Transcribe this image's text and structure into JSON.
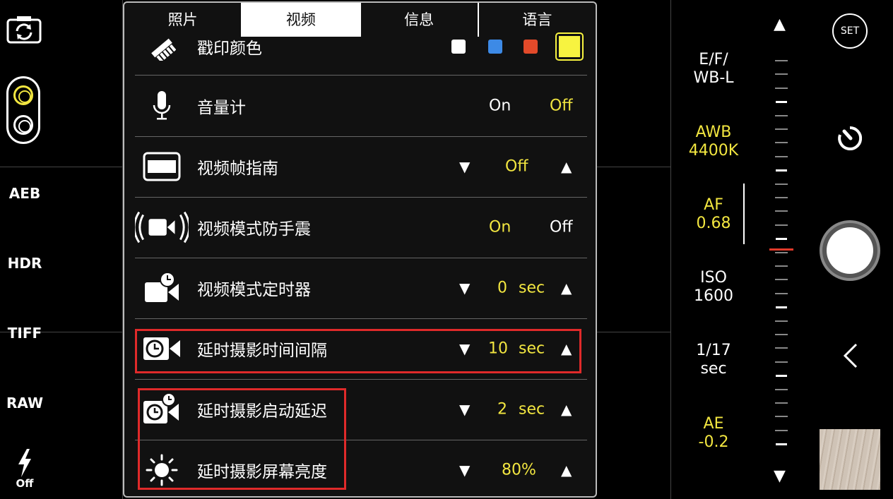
{
  "tabs": [
    {
      "label": "照片",
      "active": false
    },
    {
      "label": "视频",
      "active": true
    },
    {
      "label": "信息",
      "active": false
    },
    {
      "label": "语言",
      "active": false
    }
  ],
  "settings": [
    {
      "label": "戳印颜色",
      "icon": "stamp-icon",
      "colors": [
        "#ffffff",
        "#3d8ae6",
        "#e24a2a",
        "#f7f340"
      ],
      "selected_color": "#f7f340"
    },
    {
      "label": "音量计",
      "icon": "microphone-icon",
      "options": [
        "On",
        "Off"
      ],
      "selected": "Off"
    },
    {
      "label": "视频帧指南",
      "icon": "frame-guide-icon",
      "value": "Off"
    },
    {
      "label": "视频模式防手震",
      "icon": "stabilization-icon",
      "options": [
        "On",
        "Off"
      ],
      "selected": "On"
    },
    {
      "label": "视频模式定时器",
      "icon": "video-timer-icon",
      "value": "0",
      "unit": "sec"
    },
    {
      "label": "延时摄影时间间隔",
      "icon": "timelapse-interval-icon",
      "value": "10",
      "unit": "sec"
    },
    {
      "label": "延时摄影启动延迟",
      "icon": "timelapse-delay-icon",
      "value": "2",
      "unit": "sec"
    },
    {
      "label": "延时摄影屏幕亮度",
      "icon": "brightness-icon",
      "value": "80%"
    }
  ],
  "left_bar": {
    "aeb": "AEB",
    "hdr": "HDR",
    "tiff": "TIFF",
    "raw": "RAW",
    "flash_label": "Off"
  },
  "right_info": {
    "efwb_line1": "E/F/",
    "efwb_line2": "WB-L",
    "awb_line1": "AWB",
    "awb_line2": "4400K",
    "af_line1": "AF",
    "af_line2": "0.68",
    "iso_line1": "ISO",
    "iso_line2": "1600",
    "shutter_line1": "1/17",
    "shutter_line2": "sec",
    "ae_line1": "AE",
    "ae_line2": "-0.2"
  },
  "set_label": "SET",
  "accent_color": "#f2e640",
  "highlight_color": "#e02a2a"
}
